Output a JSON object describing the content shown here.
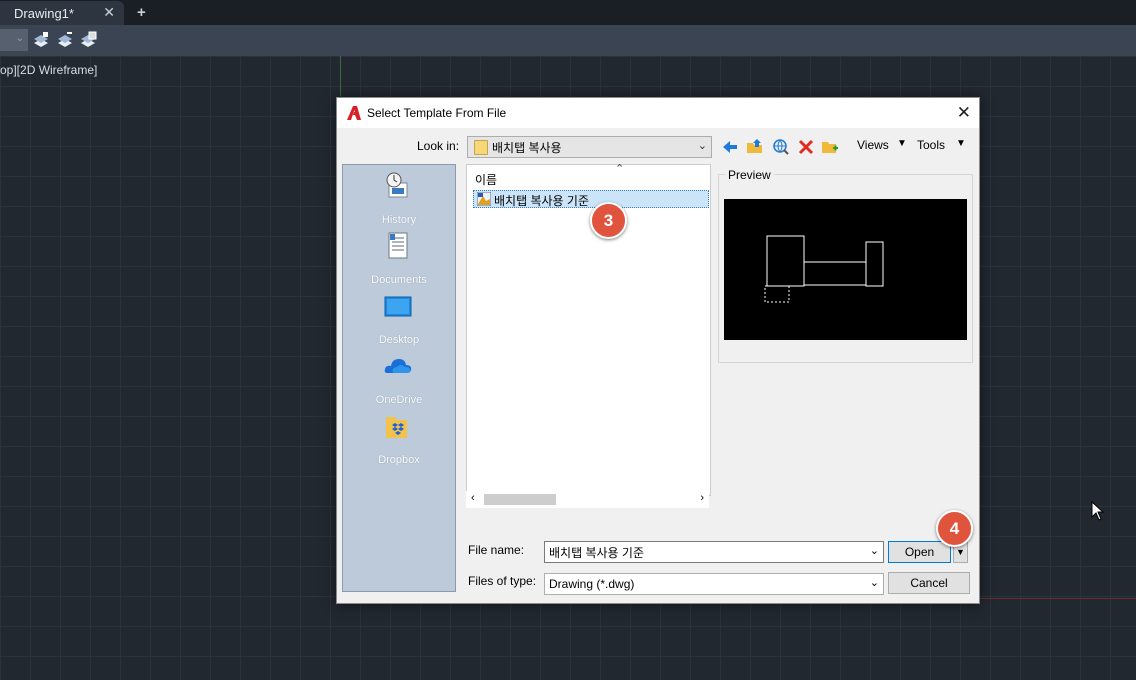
{
  "tabbar": {
    "doc_tab_label": "Drawing1*",
    "close_glyph": "✕",
    "new_tab_glyph": "+"
  },
  "viewport": {
    "view_label": "op][2D Wireframe]"
  },
  "dialog": {
    "title": "Select Template From File",
    "close_glyph": "✕",
    "look_in_label": "Look in:",
    "look_in_value": "배치탭 복사용",
    "views_label": "Views",
    "tools_label": "Tools",
    "places": [
      {
        "label": "History",
        "icon": "history-icon"
      },
      {
        "label": "Documents",
        "icon": "documents-icon"
      },
      {
        "label": "Desktop",
        "icon": "desktop-icon"
      },
      {
        "label": "OneDrive",
        "icon": "onedrive-icon"
      },
      {
        "label": "Dropbox",
        "icon": "dropbox-icon"
      }
    ],
    "file_list": {
      "column_header": "이름",
      "items": [
        {
          "name": "배치탭 복사용 기준",
          "selected": true
        }
      ]
    },
    "preview_label": "Preview",
    "file_name_label": "File name:",
    "file_name_value": "배치탭 복사용 기준",
    "files_of_type_label": "Files of type:",
    "files_of_type_value": "Drawing (*.dwg)",
    "open_label": "Open",
    "cancel_label": "Cancel"
  },
  "annotations": {
    "step_3": "3",
    "step_4": "4"
  },
  "colors": {
    "accent": "#0078d7",
    "badge": "#e0543e",
    "canvas": "#212830"
  }
}
